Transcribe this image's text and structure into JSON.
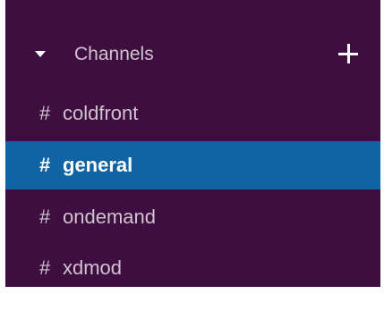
{
  "sidebar": {
    "background": "#3f0e40",
    "section": {
      "title": "Channels",
      "collapse_icon": "caret-down-icon",
      "add_icon": "plus-icon"
    },
    "channels": [
      {
        "name": "coldfront",
        "selected": false
      },
      {
        "name": "general",
        "selected": true
      },
      {
        "name": "ondemand",
        "selected": false
      },
      {
        "name": "xdmod",
        "selected": false
      }
    ],
    "hash_symbol": "#",
    "selected_color": "#1164a3"
  }
}
